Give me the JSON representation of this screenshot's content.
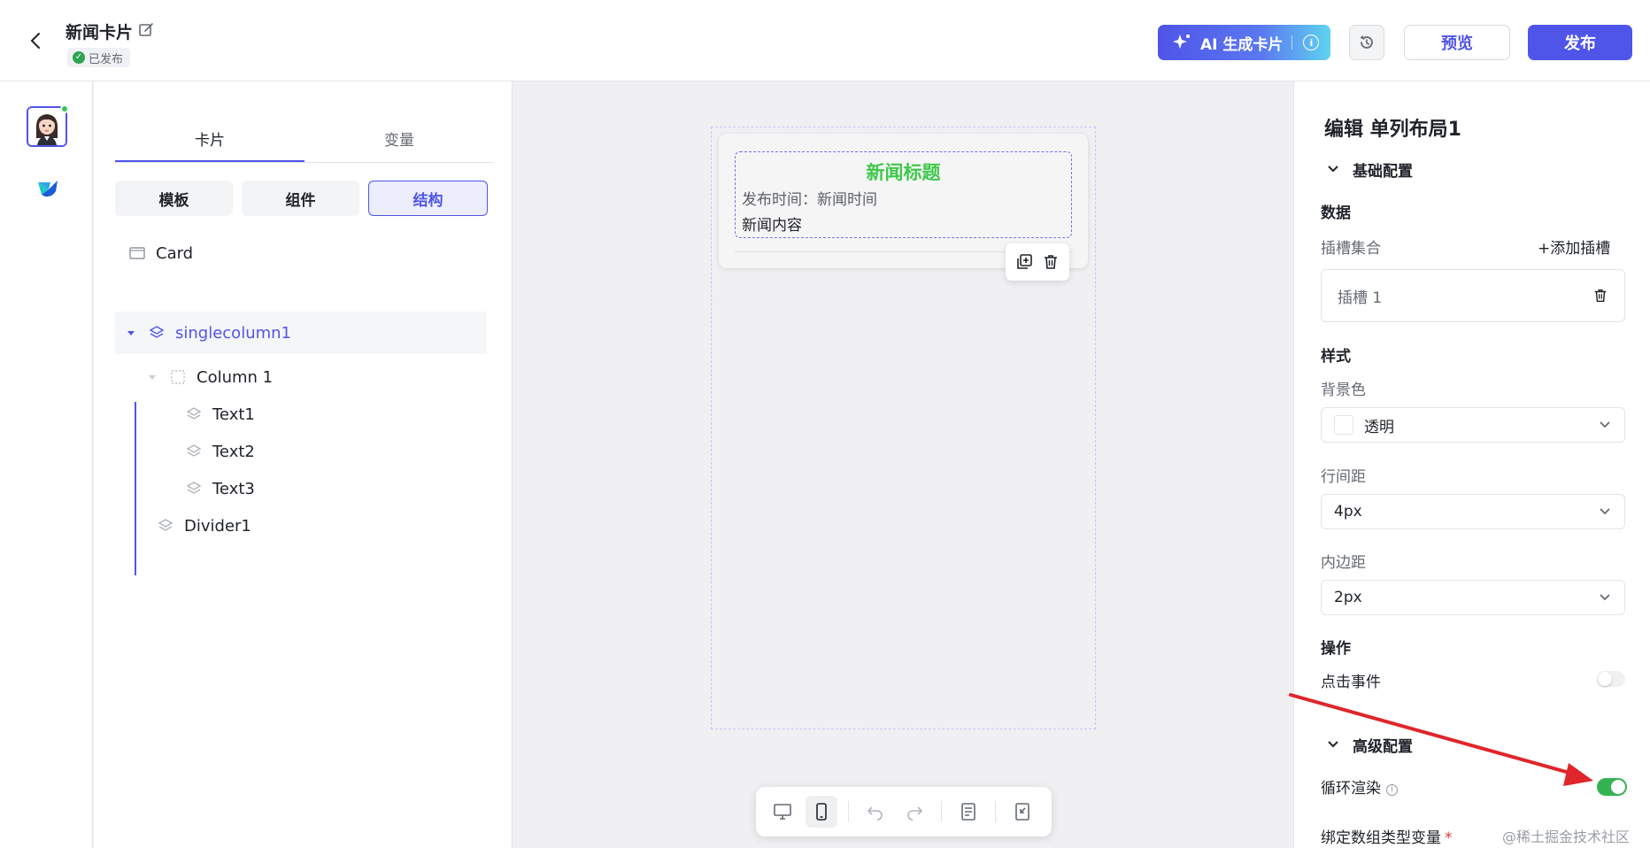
{
  "header": {
    "title": "新闻卡片",
    "status": "已发布",
    "ai_button": "AI 生成卡片",
    "preview": "预览",
    "publish": "发布"
  },
  "structure_panel": {
    "tabs": [
      "卡片",
      "变量"
    ],
    "segments": [
      "模板",
      "组件",
      "结构"
    ],
    "tree": [
      {
        "label": "Card"
      },
      {
        "label": "singlecolumn1"
      },
      {
        "label": "Column 1"
      },
      {
        "label": "Text1"
      },
      {
        "label": "Text2"
      },
      {
        "label": "Text3"
      },
      {
        "label": "Divider1"
      }
    ]
  },
  "card_preview": {
    "title": "新闻标题",
    "time_line": "发布时间：新闻时间",
    "content": "新闻内容"
  },
  "properties": {
    "title": "编辑 单列布局1",
    "basic_section": "基础配置",
    "data_group": "数据",
    "slots_label": "插槽集合",
    "add_slot": "+添加插槽",
    "slot_item": "插槽 1",
    "style_group": "样式",
    "bg_label": "背景色",
    "bg_value": "透明",
    "line_spacing_label": "行间距",
    "line_spacing_value": "4px",
    "padding_label": "内边距",
    "padding_value": "2px",
    "action_group": "操作",
    "click_event_label": "点击事件",
    "click_event_enabled": false,
    "advanced_section": "高级配置",
    "loop_label": "循环渲染",
    "loop_enabled": true,
    "bind_label": "绑定数组类型变量",
    "bind_required_mark": "*"
  },
  "watermark": "@稀土掘金技术社区",
  "colors": {
    "accent": "#4f55e8",
    "success": "#34b352",
    "title_green": "#3fc84a",
    "annotation_arrow": "#e0252b"
  }
}
